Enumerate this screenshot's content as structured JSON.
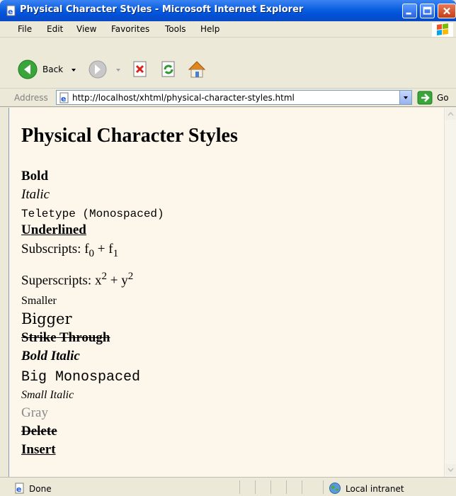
{
  "window": {
    "title": "Physical Character Styles - Microsoft Internet Explorer"
  },
  "menu": {
    "items": [
      "File",
      "Edit",
      "View",
      "Favorites",
      "Tools",
      "Help"
    ]
  },
  "toolbar": {
    "back_label": "Back"
  },
  "address": {
    "label": "Address",
    "url": "http://localhost/xhtml/physical-character-styles.html",
    "go_label": "Go"
  },
  "page": {
    "heading": "Physical Character Styles",
    "bold": "Bold",
    "italic": "Italic",
    "teletype": "Teletype (Monospaced)",
    "underlined": "Underlined",
    "subscripts": {
      "label": "Subscripts: ",
      "base1": "f",
      "sub1": "0",
      "plus": " + ",
      "base2": "f",
      "sub2": "1"
    },
    "superscripts": {
      "label": "Superscripts: ",
      "base1": "x",
      "sup1": "2",
      "plus": " + ",
      "base2": "y",
      "sup2": "2"
    },
    "smaller": "Smaller",
    "bigger": "Bigger",
    "strike": "Strike Through",
    "bold_italic": "Bold Italic",
    "big_mono": "Big Monospaced",
    "small_italic": "Small Italic",
    "gray": "Gray",
    "delete": "Delete",
    "insert": "Insert"
  },
  "status": {
    "left": "Done",
    "zone": "Local intranet"
  },
  "colors": {
    "content_bg": "#fdf6ea",
    "gray_text": "#8a8a8a",
    "title_bar": "#0a5fe0"
  }
}
